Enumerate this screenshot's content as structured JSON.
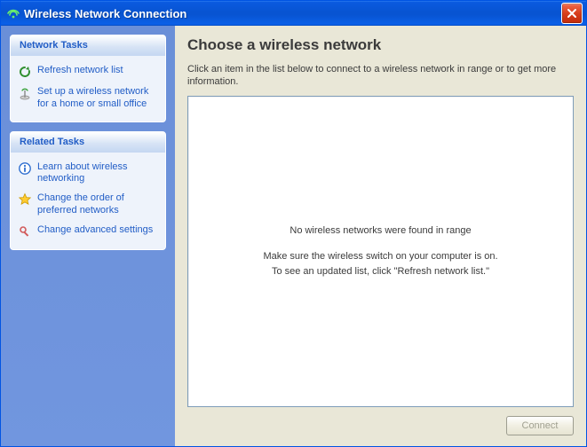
{
  "window": {
    "title": "Wireless Network Connection"
  },
  "sidebar": {
    "network_tasks": {
      "heading": "Network Tasks",
      "refresh": "Refresh network list",
      "setup": "Set up a wireless network for a home or small office"
    },
    "related_tasks": {
      "heading": "Related Tasks",
      "learn": "Learn about wireless networking",
      "order": "Change the order of preferred networks",
      "advanced": "Change advanced settings"
    }
  },
  "main": {
    "heading": "Choose a wireless network",
    "intro": "Click an item in the list below to connect to a wireless network in range or to get more information.",
    "empty_title": "No wireless networks were found in range",
    "empty_line1": "Make sure the wireless switch on your computer is on.",
    "empty_line2": "To see an updated list, click \"Refresh network list.\"",
    "connect_button": "Connect"
  }
}
